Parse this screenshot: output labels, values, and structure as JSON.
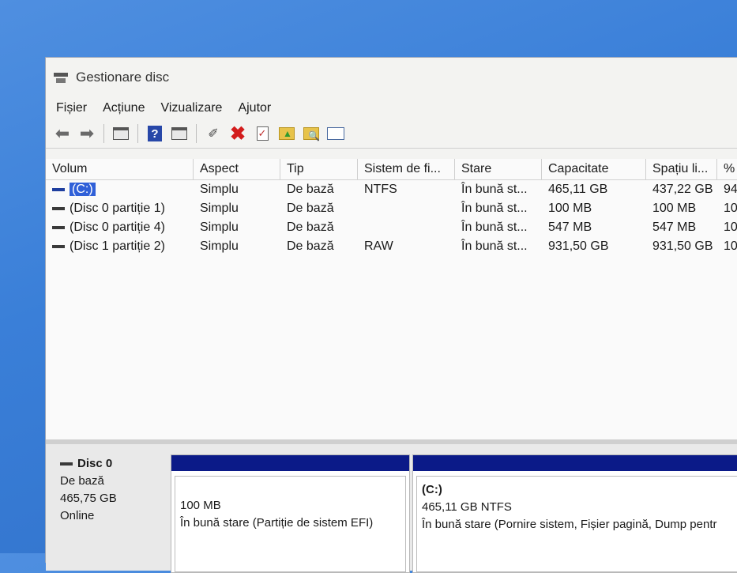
{
  "window": {
    "title": "Gestionare disc"
  },
  "menu": [
    "Fișier",
    "Acțiune",
    "Vizualizare",
    "Ajutor"
  ],
  "table": {
    "headers": [
      "Volum",
      "Aspect",
      "Tip",
      "Sistem de fi...",
      "Stare",
      "Capacitate",
      "Spațiu li...",
      "%"
    ],
    "rows": [
      [
        "(C:)",
        "Simplu",
        "De bază",
        "NTFS",
        "În bună st...",
        "465,11 GB",
        "437,22 GB",
        "94"
      ],
      [
        "(Disc 0 partiție 1)",
        "Simplu",
        "De bază",
        "",
        "În bună st...",
        "100 MB",
        "100 MB",
        "10"
      ],
      [
        "(Disc 0 partiție 4)",
        "Simplu",
        "De bază",
        "",
        "În bună st...",
        "547 MB",
        "547 MB",
        "10"
      ],
      [
        "(Disc 1 partiție 2)",
        "Simplu",
        "De bază",
        "RAW",
        "În bună st...",
        "931,50 GB",
        "931,50 GB",
        "10"
      ]
    ]
  },
  "disk": {
    "name": "Disc 0",
    "type": "De bază",
    "size": "465,75 GB",
    "status": "Online",
    "partitions": [
      {
        "label": "",
        "size": "100 MB",
        "status": "În bună stare (Partiție de sistem EFI)"
      },
      {
        "label": "(C:)",
        "size": "465,11 GB NTFS",
        "status": "În bună stare (Pornire sistem, Fișier pagină, Dump pentr"
      }
    ]
  },
  "colors": {
    "partition_bar": "#0b1a88",
    "selection": "#3060d8",
    "desktop": "#3a7fd8"
  }
}
